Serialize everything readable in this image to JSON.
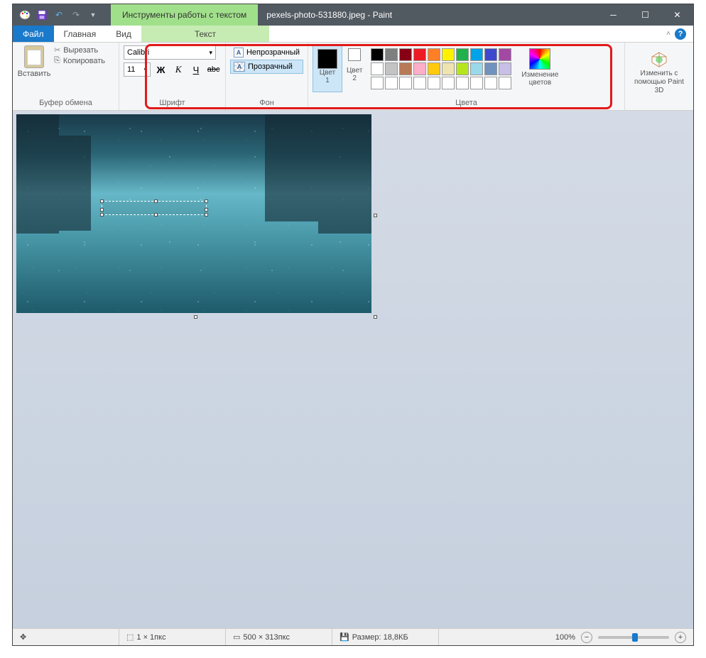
{
  "title": {
    "context": "Инструменты работы с текстом",
    "filename": "pexels-photo-531880.jpeg - Paint"
  },
  "tabs": {
    "file": "Файл",
    "home": "Главная",
    "view": "Вид",
    "text": "Текст"
  },
  "clipboard": {
    "paste": "Вставить",
    "cut": "Вырезать",
    "copy": "Копировать",
    "label": "Буфер обмена"
  },
  "font": {
    "name": "Calibri",
    "size": "11",
    "bold": "Ж",
    "italic": "К",
    "underline": "Ч",
    "strike": "abc",
    "label": "Шрифт"
  },
  "bg": {
    "opaque": "Непрозрачный",
    "transparent": "Прозрачный",
    "label": "Фон"
  },
  "colors": {
    "c1": "Цвет\n1",
    "c2": "Цвет\n2",
    "row1": [
      "#000000",
      "#7f7f7f",
      "#880015",
      "#ed1c24",
      "#ff7f27",
      "#fff200",
      "#22b14c",
      "#00a2e8",
      "#3f48cc",
      "#a349a4"
    ],
    "row2": [
      "#ffffff",
      "#c3c3c3",
      "#b97a57",
      "#ffaec9",
      "#ffc90e",
      "#efe4b0",
      "#b5e61d",
      "#99d9ea",
      "#7092be",
      "#c8bfe7"
    ],
    "row3": [
      "#ffffff",
      "#ffffff",
      "#ffffff",
      "#ffffff",
      "#ffffff",
      "#ffffff",
      "#ffffff",
      "#ffffff",
      "#ffffff",
      "#ffffff"
    ],
    "edit": "Изменение\nцветов",
    "label": "Цвета"
  },
  "p3d": "Изменить с\nпомощью Paint 3D",
  "status": {
    "cursor": "1 × 1пкс",
    "canvas": "500 × 313пкс",
    "filesize": "Размер: 18,8КБ",
    "zoom": "100%"
  }
}
